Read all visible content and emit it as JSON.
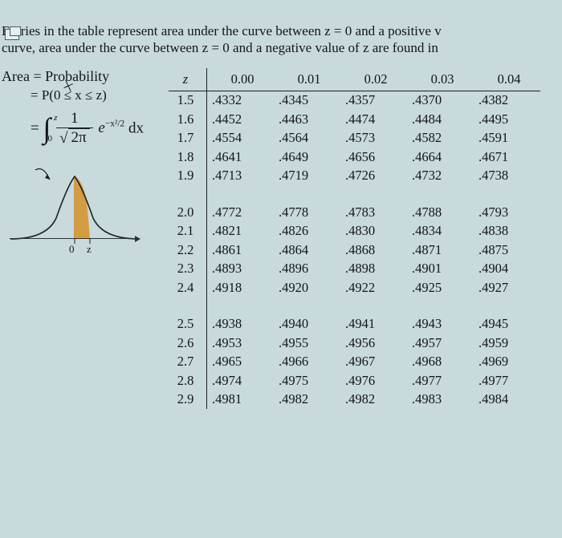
{
  "intro_line1": "Entries in the table represent area under the curve between z = 0 and a positive v",
  "intro_line2": "curve, area under the curve between z = 0 and a negative value of z are found in ",
  "left": {
    "line1_a": "Area = ",
    "line1_b": "Pro",
    "line1_c": "bability",
    "line2": "= P(0 ≤ x ≤ z)",
    "eq_eq": "= ",
    "int_lb": "0",
    "int_ub": "z",
    "frac_num": "1",
    "frac_den_rad": "2π",
    "e": "e",
    "exp": "−x²/2",
    "dx": " dx",
    "zero": "0",
    "z": "z"
  },
  "table": {
    "header_z": "z",
    "cols": [
      "0.00",
      "0.01",
      "0.02",
      "0.03",
      "0.04"
    ],
    "block1": [
      {
        "z": "1.5",
        "v": [
          ".4332",
          ".4345",
          ".4357",
          ".4370",
          ".4382"
        ]
      },
      {
        "z": "1.6",
        "v": [
          ".4452",
          ".4463",
          ".4474",
          ".4484",
          ".4495"
        ]
      },
      {
        "z": "1.7",
        "v": [
          ".4554",
          ".4564",
          ".4573",
          ".4582",
          ".4591"
        ]
      },
      {
        "z": "1.8",
        "v": [
          ".4641",
          ".4649",
          ".4656",
          ".4664",
          ".4671"
        ]
      },
      {
        "z": "1.9",
        "v": [
          ".4713",
          ".4719",
          ".4726",
          ".4732",
          ".4738"
        ]
      }
    ],
    "block2": [
      {
        "z": "2.0",
        "v": [
          ".4772",
          ".4778",
          ".4783",
          ".4788",
          ".4793"
        ]
      },
      {
        "z": "2.1",
        "v": [
          ".4821",
          ".4826",
          ".4830",
          ".4834",
          ".4838"
        ]
      },
      {
        "z": "2.2",
        "v": [
          ".4861",
          ".4864",
          ".4868",
          ".4871",
          ".4875"
        ]
      },
      {
        "z": "2.3",
        "v": [
          ".4893",
          ".4896",
          ".4898",
          ".4901",
          ".4904"
        ]
      },
      {
        "z": "2.4",
        "v": [
          ".4918",
          ".4920",
          ".4922",
          ".4925",
          ".4927"
        ]
      }
    ],
    "block3": [
      {
        "z": "2.5",
        "v": [
          ".4938",
          ".4940",
          ".4941",
          ".4943",
          ".4945"
        ]
      },
      {
        "z": "2.6",
        "v": [
          ".4953",
          ".4955",
          ".4956",
          ".4957",
          ".4959"
        ]
      },
      {
        "z": "2.7",
        "v": [
          ".4965",
          ".4966",
          ".4967",
          ".4968",
          ".4969"
        ]
      },
      {
        "z": "2.8",
        "v": [
          ".4974",
          ".4975",
          ".4976",
          ".4977",
          ".4977"
        ]
      },
      {
        "z": "2.9",
        "v": [
          ".4981",
          ".4982",
          ".4982",
          ".4983",
          ".4984"
        ]
      }
    ]
  }
}
